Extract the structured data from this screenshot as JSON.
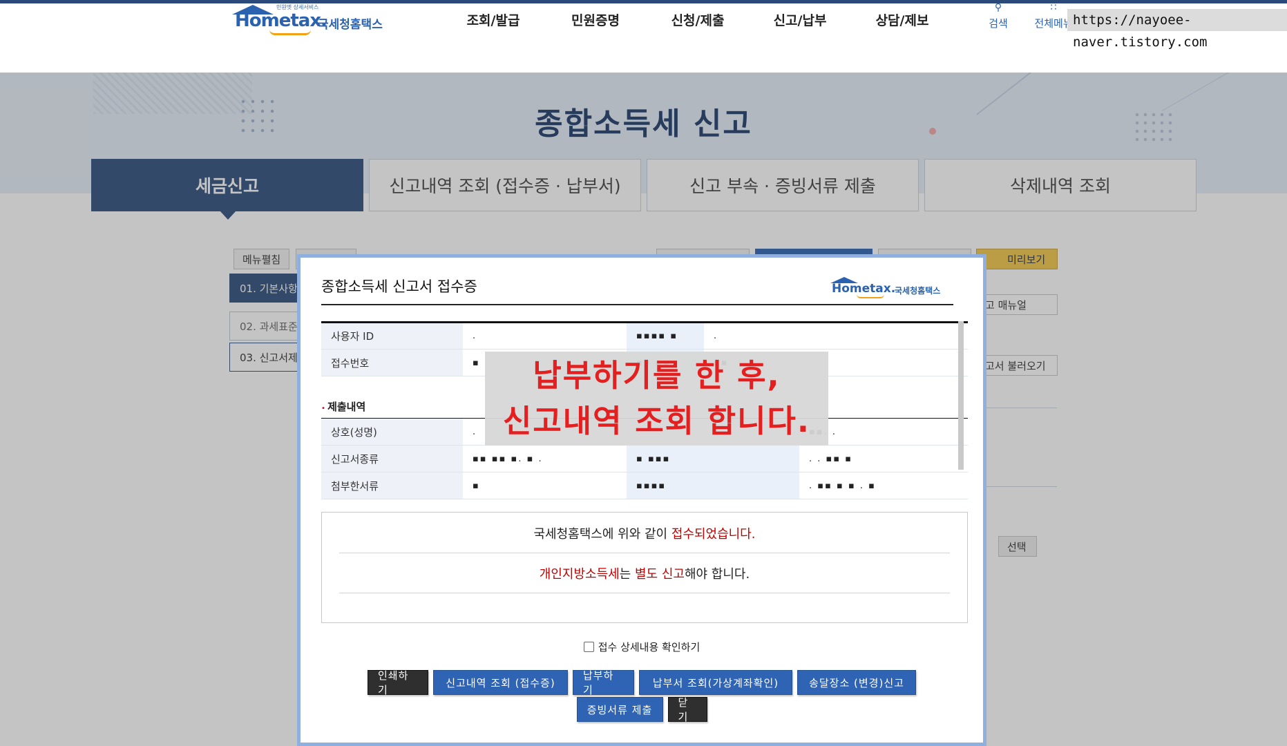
{
  "header": {
    "logo_sub": "민원엣 상세서비스",
    "logo_main": "Hometax.",
    "logo_ko": "국세청홈택스",
    "nav": [
      "조회/발급",
      "민원증명",
      "신청/제출",
      "신고/납부",
      "상담/제보"
    ],
    "util": [
      {
        "icon": "search-icon",
        "label": "검색"
      },
      {
        "icon": "grid-menu-icon",
        "label": "전체메뉴"
      }
    ],
    "watermark": "https://nayoee-naver.tistory.com"
  },
  "banner": {
    "title": "종합소득세 신고"
  },
  "tabs": [
    "세금신고",
    "신고내역 조회 (접수증 · 납부서)",
    "신고 부속 · 증빙서류 제출",
    "삭제내역 조회"
  ],
  "background": {
    "menu_edit": "메뉴펼침",
    "preview": "미리보기",
    "manual": "고 매뉴얼",
    "load": "고서 불러오기",
    "select": "선택",
    "steps": [
      "01. 기본사항",
      "02. 과세표준",
      "03. 신고서제"
    ]
  },
  "modal": {
    "title": "종합소득세 신고서 접수증",
    "logo_main": "Hometax.",
    "logo_ko": "국세청홈택스",
    "top_rows": [
      {
        "label": "사용자 ID",
        "values": [
          ".",
          "▪▪▪▪ ▪",
          "."
        ]
      },
      {
        "label": "접수번호",
        "values": [
          "▪",
          "▪▪ ▪▪",
          "▪▪"
        ]
      }
    ],
    "section": "제출내역",
    "sub_rows": [
      {
        "label": "상호(성명)",
        "values": [
          ".",
          "",
          "▪▪. ."
        ]
      },
      {
        "label": "신고서종류",
        "values": [
          "▪▪ ▪▪ ▪. ▪ .",
          "▪ ▪▪▪",
          ". . ▪▪ ▪"
        ]
      },
      {
        "label": "첨부한서류",
        "values": [
          "▪",
          "▪▪▪▪",
          ". ▪▪ ▪ ▪ . ▪"
        ]
      }
    ],
    "overlay_note": [
      "납부하기를 한 후,",
      "신고내역 조회 합니다."
    ],
    "notice": {
      "line1_pre": "국세청홈택스에 위와 같이 ",
      "line1_red": "접수되었습니다.",
      "line2_red1": "개인지방소득세",
      "line2_mid": "는 ",
      "line2_red2": "별도 신고",
      "line2_post": "해야 합니다."
    },
    "checkbox_label": "접수 상세내용 확인하기",
    "buttons_row1": [
      "인쇄하기",
      "신고내역 조회 (접수증)",
      "납부하기",
      "납부서 조회(가상계좌확인)",
      "송달장소 (변경)신고"
    ],
    "buttons_row2": [
      "증빙서류 제출",
      "닫기"
    ]
  }
}
